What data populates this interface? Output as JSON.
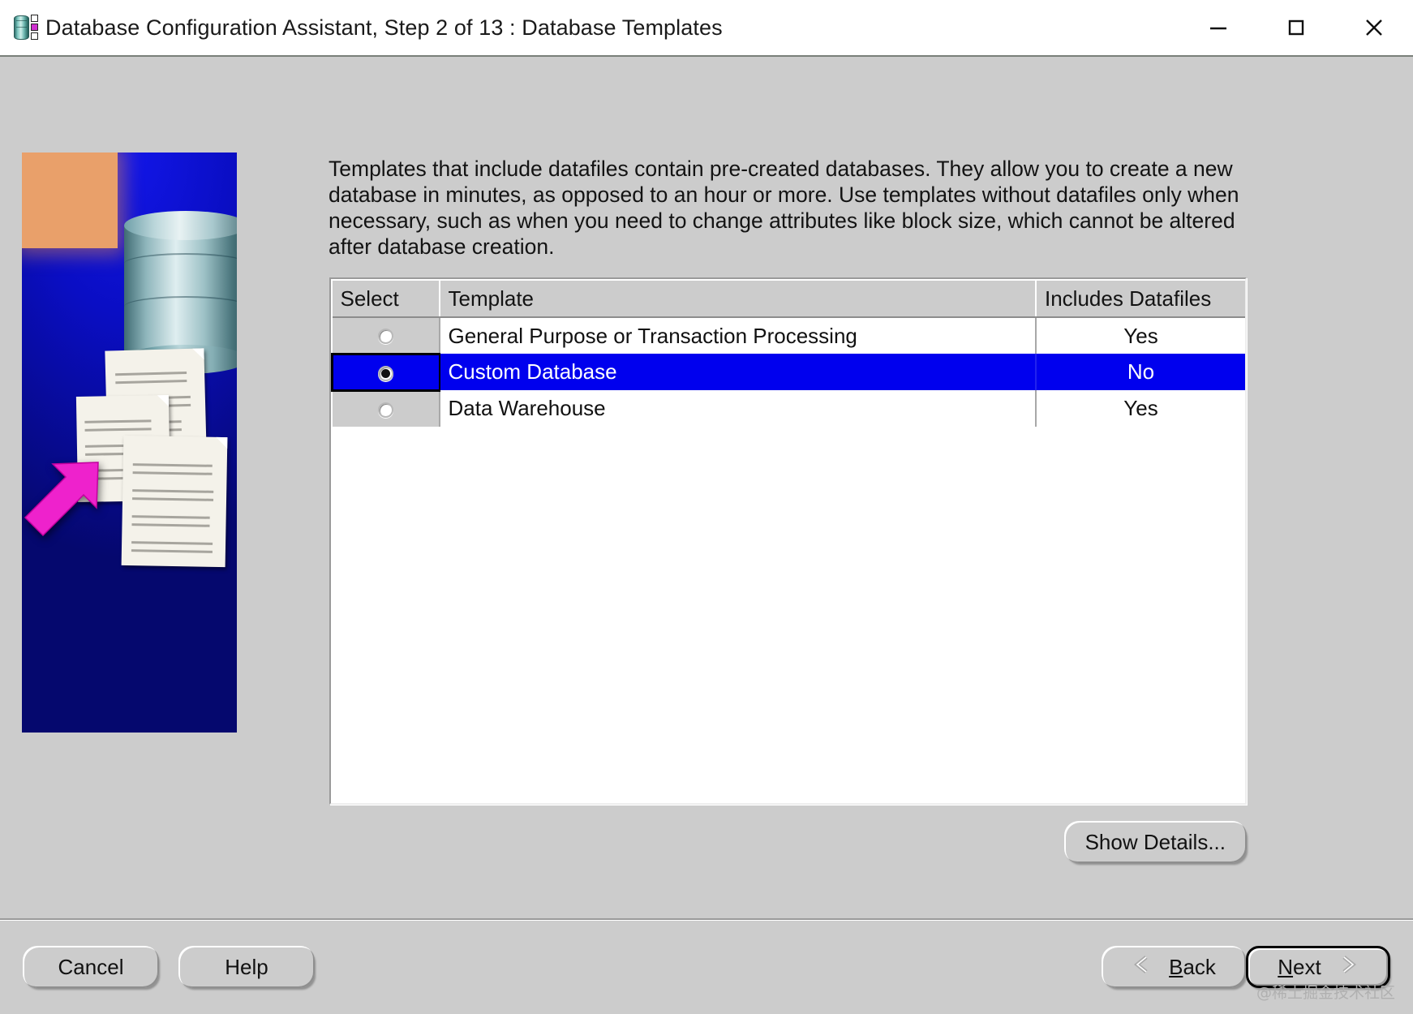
{
  "window": {
    "title": "Database Configuration Assistant, Step 2 of 13 : Database Templates",
    "app_icon": "database-cylinder-icon",
    "controls": {
      "minimize": "minimize-icon",
      "maximize": "maximize-icon",
      "close": "close-icon"
    }
  },
  "illustration": {
    "alt": "oracle-database-templates-illustration",
    "background_color": "#0a0ec4",
    "arrow_color": "#ee22cc"
  },
  "main": {
    "description": "Templates that include datafiles contain pre-created databases. They allow you to create a new database in minutes, as opposed to an hour or more. Use templates without datafiles only when necessary, such as when you need to change attributes like block size, which cannot be altered after database creation.",
    "table": {
      "columns": [
        "Select",
        "Template",
        "Includes Datafiles"
      ],
      "rows": [
        {
          "selected": false,
          "template": "General Purpose or Transaction Processing",
          "includes_datafiles": "Yes"
        },
        {
          "selected": true,
          "template": "Custom Database",
          "includes_datafiles": "No"
        },
        {
          "selected": false,
          "template": "Data Warehouse",
          "includes_datafiles": "Yes"
        }
      ],
      "selected_index": 1,
      "selection_color": "#0000ee"
    },
    "show_details_label": "Show Details..."
  },
  "footer": {
    "cancel_label": "Cancel",
    "help_label": "Help",
    "back_label": "Back",
    "back_mnemonic": "B",
    "next_label": "Next",
    "next_mnemonic": "N",
    "back_icon": "double-chevron-left-icon",
    "next_icon": "double-chevron-right-icon",
    "default_button": "Next"
  },
  "watermark": "@稀土掘金技术社区"
}
